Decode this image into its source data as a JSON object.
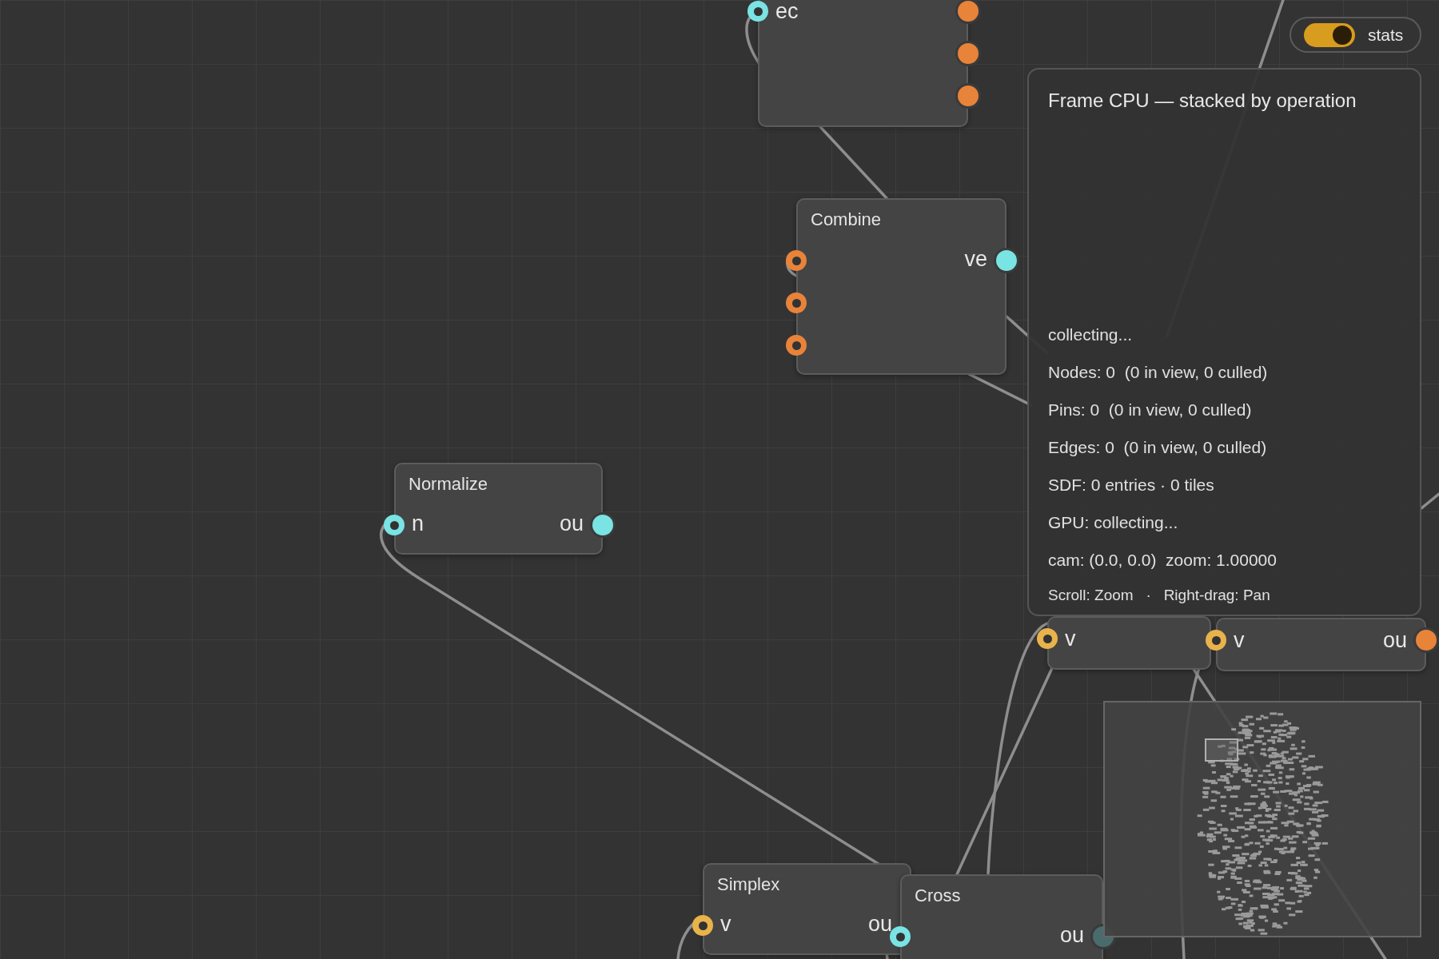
{
  "nodes": [
    {
      "inputs": [
        {
          "label": "ec",
          "color": "#7ae3e3",
          "kind": "ring"
        }
      ],
      "outputs": [
        {
          "color": "#e8833a",
          "kind": "dot"
        },
        {
          "color": "#e8833a",
          "kind": "dot"
        },
        {
          "color": "#e8833a",
          "kind": "dot"
        }
      ]
    },
    {
      "title": "Combine",
      "inputs": [
        {
          "color": "#e8833a",
          "kind": "ring"
        },
        {
          "color": "#e8833a",
          "kind": "ring"
        },
        {
          "color": "#e8833a",
          "kind": "ring"
        }
      ],
      "outputs": [
        {
          "label": "ve",
          "color": "#7ae3e3",
          "kind": "dot"
        }
      ]
    },
    {
      "title": "Normalize",
      "inputs": [
        {
          "label": "n",
          "color": "#7ae3e3",
          "kind": "ring"
        }
      ],
      "outputs": [
        {
          "label": "ou",
          "color": "#7ae3e3",
          "kind": "dot"
        }
      ]
    },
    {
      "inputs": [
        {
          "label": "v",
          "color": "#e8b34a",
          "kind": "ring"
        }
      ]
    },
    {
      "inputs": [
        {
          "label": "v",
          "color": "#e8b34a",
          "kind": "ring"
        }
      ],
      "outputs": [
        {
          "label": "ou",
          "color": "#e8833a",
          "kind": "dot"
        }
      ]
    },
    {
      "title": "Simplex",
      "inputs": [
        {
          "label": "v",
          "color": "#e8b34a",
          "kind": "ring"
        }
      ],
      "outputs": [
        {
          "label": "ou"
        }
      ]
    },
    {
      "title": "Cross",
      "inputs": [
        {
          "color": "#7ae3e3",
          "kind": "ring"
        }
      ],
      "outputs": [
        {
          "label": "ou",
          "color": "#4a6b6b",
          "kind": "dot"
        }
      ]
    }
  ],
  "stats_toggle": {
    "label": "stats",
    "on": true
  },
  "stats_panel": {
    "title": "Frame CPU — stacked by operation",
    "lines": [
      "collecting...",
      "Nodes: 0  (0 in view, 0 culled)",
      "Pins: 0  (0 in view, 0 culled)",
      "Edges: 0  (0 in view, 0 culled)",
      "SDF: 0 entries · 0 tiles",
      "GPU: collecting...",
      "cam: (0.0, 0.0)  zoom: 1.00000"
    ],
    "hint": "Scroll: Zoom   ·   Right-drag: Pan"
  }
}
